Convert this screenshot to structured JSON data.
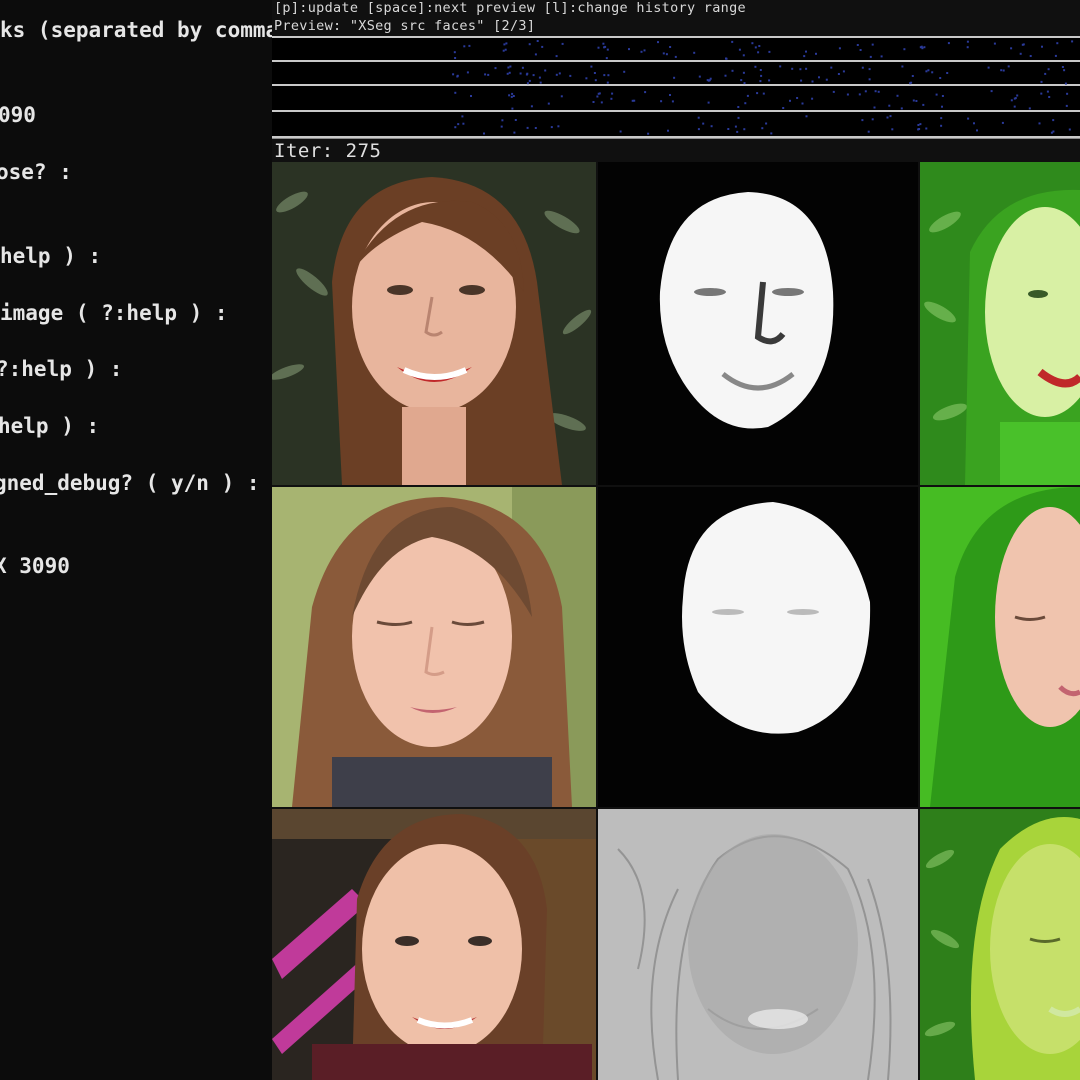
{
  "console": {
    "lines": [
      "ks (separated by comma",
      "",
      "090",
      "",
      "ose? :",
      "",
      "",
      "help ) :",
      "",
      "image ( ?:help ) :",
      "",
      "?:help ) :",
      "",
      "help ) :",
      "",
      "gned_debug? ( y/n ) :",
      "",
      "",
      "X 3090"
    ]
  },
  "preview": {
    "keys_line": "[p]:update [space]:next preview [l]:change history range",
    "preview_line": "Preview: \"XSeg src faces\" [2/3]",
    "iter_label": "Iter: 275"
  },
  "colors": {
    "console_bg": "#0c0c0c",
    "console_text": "#e6e6e6",
    "graph_bg": "#000000",
    "graph_points": "#2a3a9a",
    "overlay_green": "#3ec41a"
  },
  "grid": {
    "columns": [
      "source face",
      "predicted mask",
      "mask overlay"
    ],
    "rows": 3
  }
}
